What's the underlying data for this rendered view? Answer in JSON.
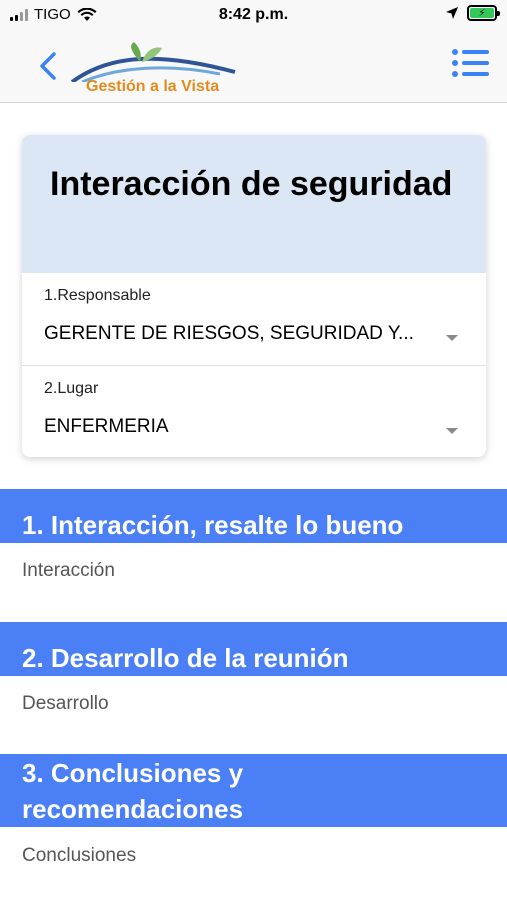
{
  "status_bar": {
    "carrier": "TIGO",
    "time": "8:42 p.m."
  },
  "nav": {
    "logo_text": "Gestión a la Vista",
    "back_icon": "chevron-left-icon",
    "menu_icon": "list-icon"
  },
  "card": {
    "title": "Interacción de seguridad",
    "fields": [
      {
        "label": "1.Responsable",
        "value": "GERENTE DE RIESGOS, SEGURIDAD Y..."
      },
      {
        "label": "2.Lugar",
        "value": "ENFERMERIA"
      }
    ]
  },
  "sections": [
    {
      "header": "1. Interacción, resalte lo bueno",
      "text": "Interacción"
    },
    {
      "header": "2. Desarrollo de la reunión",
      "text": "Desarrollo"
    },
    {
      "header": "3. Conclusiones y recomendaciones",
      "text": "Conclusiones"
    }
  ],
  "colors": {
    "accent": "#4a7ff5",
    "card_header_bg": "#dbe7f5",
    "logo_orange": "#e38b1f",
    "nav_icon": "#3b82f6"
  }
}
